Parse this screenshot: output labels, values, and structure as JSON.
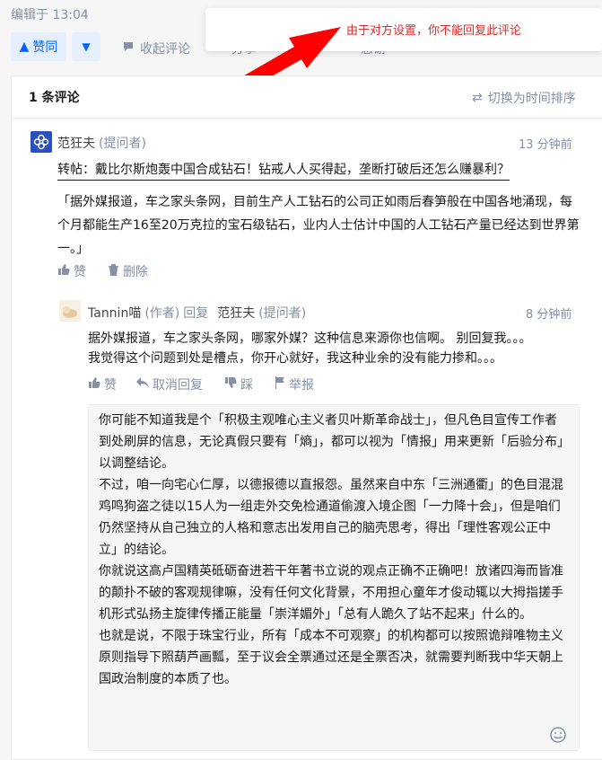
{
  "header": {
    "edited_label": "编辑于 13:04"
  },
  "toolbar": {
    "upvote_label": "赞同",
    "collapse_label": "收起评论",
    "share_label": "分享",
    "thanks_label": "感谢"
  },
  "popup": {
    "message": "由于对方设置，你不能回复此评论"
  },
  "comments_header": {
    "count_label": "1 条评论",
    "sort_label": "切换为时间排序"
  },
  "comment": {
    "author": "范狂夫",
    "role": "(提问者)",
    "time": "13 分钟前",
    "repost_title": "转帖：戴比尔斯炮轰中国合成钻石！钻戒人人买得起，垄断打破后还怎么赚暴利？",
    "body": "「据外媒报道，车之家头条网，目前生产人工钻石的公司正如雨后春笋般在中国各地涌现，每个月都能生产16至20万克拉的宝石级钻石，业内人士估计中国的人工钻石产量已经达到世界第一。」",
    "like_label": "赞",
    "delete_label": "删除"
  },
  "reply": {
    "author": "Tannin喵",
    "author_role": "(作者)",
    "reply_word": "回复",
    "target": "范狂夫",
    "target_role": "(提问者)",
    "time": "8 分钟前",
    "body_line1": "据外媒报道，车之家头条网，哪家外媒？这种信息来源你也信啊。 别回复我。。。",
    "body_line2": "我觉得这个问题到处是槽点，你开心就好，我这种业余的没有能力掺和。。。",
    "like_label": "赞",
    "cancel_reply_label": "取消回复",
    "dislike_label": "踩",
    "report_label": "举报"
  },
  "reply_editor": {
    "paragraphs": [
      "你可能不知道我是个「积极主观唯心主义者贝叶斯革命战士」，但凡色目宣传工作者到处刷屏的信息，无论真假只要有「熵」，都可以视为「情报」用来更新「后验分布」以调整结论。",
      "不过，咱一向宅心仁厚，以德报德以直报怨。虽然来自中东「三洲通衢」的色目混混鸡鸣狗盗之徒以15人为一组走外交免检通道偷渡入境企图「一力降十会」，但是咱们仍然坚持从自己独立的人格和意志出发用自己的脑壳思考，得出「理性客观公正中立」的结论。",
      "你就说这高卢国精英砥砺奋进若干年著书立说的观点正确不正确吧！放诸四海而皆准的颠扑不破的客观规律嘛，没有任何文化背景，不用担心童年才俊动辄以大拇指搓手机形式弘扬主旋律传播正能量「崇洋媚外」「总有人跪久了站不起来」什么的。",
      "也就是说，不限于珠宝行业，所有「成本不可观察」的机构都可以按照诡辩唯物主义原则指导下照葫芦画瓢，至于议会全票通过还是全票否决，就需要判断我中华天朝上国政治制度的本质了也。"
    ]
  },
  "colors": {
    "accent": "#0066ff",
    "warning": "#e02a2a",
    "muted": "#8590a6"
  }
}
